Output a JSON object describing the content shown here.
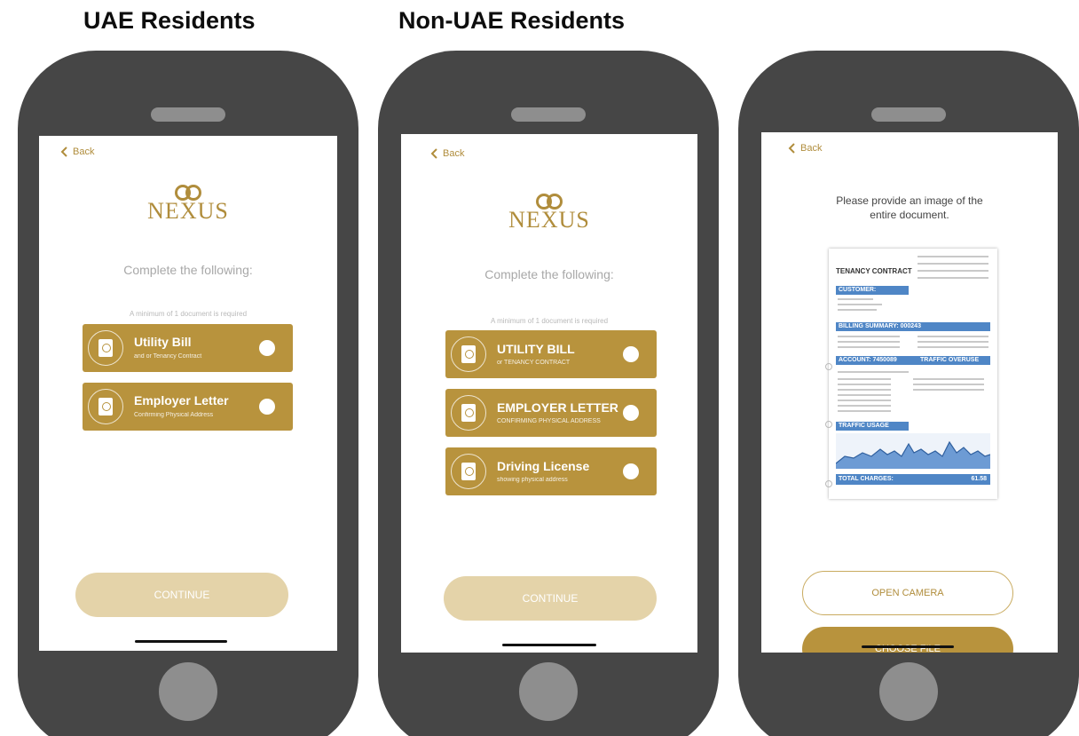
{
  "headings": {
    "left": "UAE Residents",
    "middle": "Non-UAE Residents"
  },
  "colors": {
    "phone_body": "#464646",
    "accent_gold": "#b8933d",
    "continue_disabled": "#e4d3a9",
    "doc_blue": "#4f86c6"
  },
  "phone1": {
    "back": "Back",
    "logo": "NEXUS",
    "subtitle": "Complete the following:",
    "min_required": "A minimum of 1 document is required",
    "documents": [
      {
        "title": "Utility Bill",
        "subtitle": "and or Tenancy Contract",
        "icon": "passport-icon"
      },
      {
        "title": "Employer Letter",
        "subtitle": "Confirming Physical Address",
        "icon": "passport-icon"
      }
    ],
    "continue": "CONTINUE"
  },
  "phone2": {
    "back": "Back",
    "logo": "NEXUS",
    "subtitle": "Complete the following:",
    "min_required": "A minimum of 1 document is required",
    "documents": [
      {
        "title": "UTILITY BILL",
        "subtitle": "or TENANCY CONTRACT",
        "icon": "passport-icon"
      },
      {
        "title": "EMPLOYER LETTER",
        "subtitle": "CONFIRMING PHYSICAL ADDRESS",
        "icon": "passport-icon"
      },
      {
        "title": "Driving License",
        "subtitle": "showing physical address",
        "icon": "passport-icon"
      }
    ],
    "continue": "CONTINUE"
  },
  "phone3": {
    "back": "Back",
    "prompt_line1": "Please provide an image of the",
    "prompt_line2": "entire document.",
    "document": {
      "title": "TENANCY CONTRACT",
      "customer": "CUSTOMER:",
      "billing_summary": "BILLING SUMMARY: 000243",
      "account": "ACCOUNT: 7450089",
      "traffic_overuse": "TRAFFIC OVERUSE",
      "traffic_usage": "TRAFFIC USAGE",
      "total_charges": "TOTAL CHARGES:",
      "total_amount": "61.58"
    },
    "open_camera": "OPEN CAMERA",
    "choose_file": "CHOOSE FILE"
  }
}
